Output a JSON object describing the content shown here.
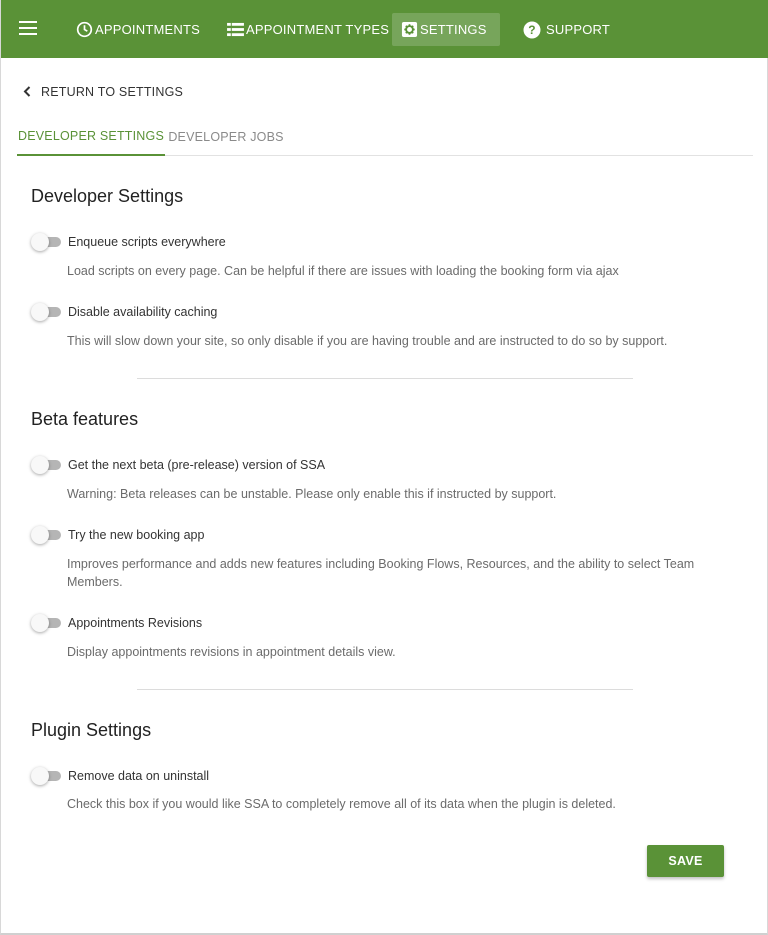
{
  "nav": {
    "items": [
      {
        "label": "APPOINTMENTS",
        "icon": "clock-icon"
      },
      {
        "label": "APPOINTMENT TYPES",
        "icon": "list-icon"
      },
      {
        "label": "SETTINGS",
        "icon": "gear-icon"
      },
      {
        "label": "SUPPORT",
        "icon": "help-icon"
      }
    ],
    "active": "SETTINGS",
    "color": "#5a9237"
  },
  "return_link": {
    "label": "RETURN TO SETTINGS",
    "icon": "chevron-left-icon"
  },
  "tabs": [
    {
      "label": "DEVELOPER SETTINGS",
      "active": true
    },
    {
      "label": "DEVELOPER JOBS",
      "active": false
    }
  ],
  "sections": [
    {
      "title": "Developer Settings",
      "settings": [
        {
          "label": "Enqueue scripts everywhere",
          "hint": "Load scripts on every page. Can be helpful if there are issues with loading the booking form via ajax",
          "enabled": false
        },
        {
          "label": "Disable availability caching",
          "hint": "This will slow down your site, so only disable if you are having trouble and are instructed to do so by support.",
          "enabled": false
        }
      ]
    },
    {
      "title": "Beta features",
      "settings": [
        {
          "label": "Get the next beta (pre-release) version of SSA",
          "hint": "Warning: Beta releases can be unstable. Please only enable this if instructed by support.",
          "enabled": false
        },
        {
          "label": "Try the new booking app",
          "hint": "Improves performance and adds new features including Booking Flows, Resources, and the ability to select Team Members.",
          "enabled": false
        },
        {
          "label": "Appointments Revisions",
          "hint": "Display appointments revisions in appointment details view.",
          "enabled": false
        }
      ]
    },
    {
      "title": "Plugin Settings",
      "settings": [
        {
          "label": "Remove data on uninstall",
          "hint": "Check this box if you would like SSA to completely remove all of its data when the plugin is deleted.",
          "enabled": false
        }
      ]
    }
  ],
  "save_label": "SAVE"
}
